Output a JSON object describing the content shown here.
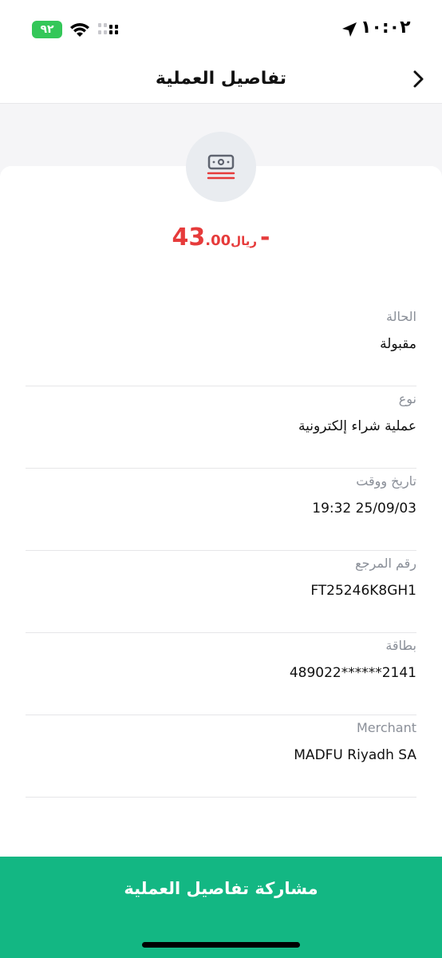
{
  "status_bar": {
    "battery": "٩٢",
    "time": "١٠:٠٢"
  },
  "header": {
    "title": "تفاصيل العملية"
  },
  "transaction": {
    "amount_sign": "-",
    "amount_main": "43",
    "amount_decimals": ".00",
    "currency": "ريال",
    "amount_color": "#e63b3b"
  },
  "details": [
    {
      "label": "الحالة",
      "value": "مقبولة"
    },
    {
      "label": "نوع",
      "value": "عملية شراء إلكترونية"
    },
    {
      "label": "تاريخ ووقت",
      "value": "19:32 25/09/03"
    },
    {
      "label": "رقم المرجع",
      "value": "FT25246K8GH1"
    },
    {
      "label": "بطاقة",
      "value": "489022******2141"
    },
    {
      "label": "Merchant",
      "value": "MADFU Riyadh SA"
    }
  ],
  "footer": {
    "share_label": "مشاركة تفاصيل العملية",
    "button_color": "#13b783"
  },
  "icons": [
    "battery-icon",
    "wifi-icon",
    "signal-icon",
    "location-arrow-icon",
    "back-chevron-icon",
    "cash-icon"
  ]
}
